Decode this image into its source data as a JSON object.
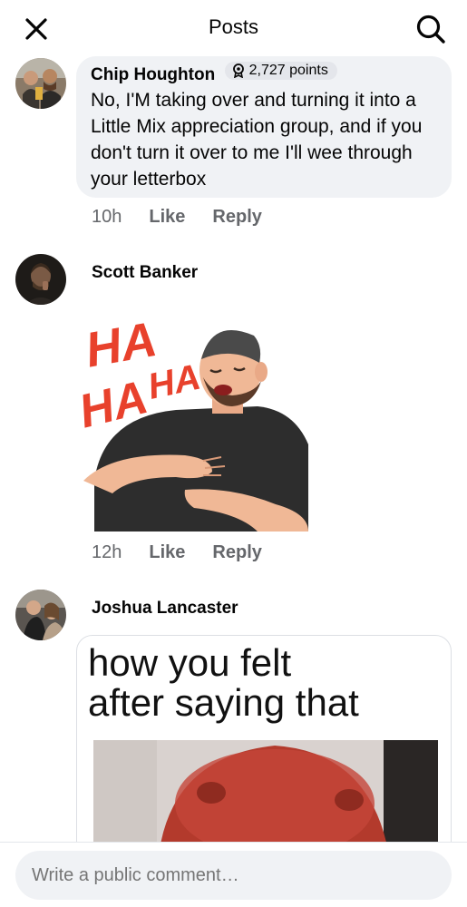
{
  "header": {
    "title": "Posts",
    "close_icon": "close-icon",
    "search_icon": "search-icon"
  },
  "comments": [
    {
      "author": "Chip Houghton",
      "points": "2,727 points",
      "points_icon": "badge-icon",
      "text": "No, I'M taking over and turning it into a Little Mix appreciation group, and if you don't turn it over to me I'll wee through your letterbox",
      "time": "10h",
      "like_label": "Like",
      "reply_label": "Reply"
    },
    {
      "author": "Scott Banker",
      "sticker_text": [
        "HA",
        "HA",
        "HA"
      ],
      "time": "12h",
      "like_label": "Like",
      "reply_label": "Reply"
    },
    {
      "author": "Joshua Lancaster",
      "meme_caption_line1": "how you felt",
      "meme_caption_line2": "after saying that"
    }
  ],
  "composer": {
    "placeholder": "Write a public comment…"
  },
  "colors": {
    "bubble": "#f0f2f5",
    "secondary_text": "#65676b",
    "sticker_red": "#e8412c"
  }
}
